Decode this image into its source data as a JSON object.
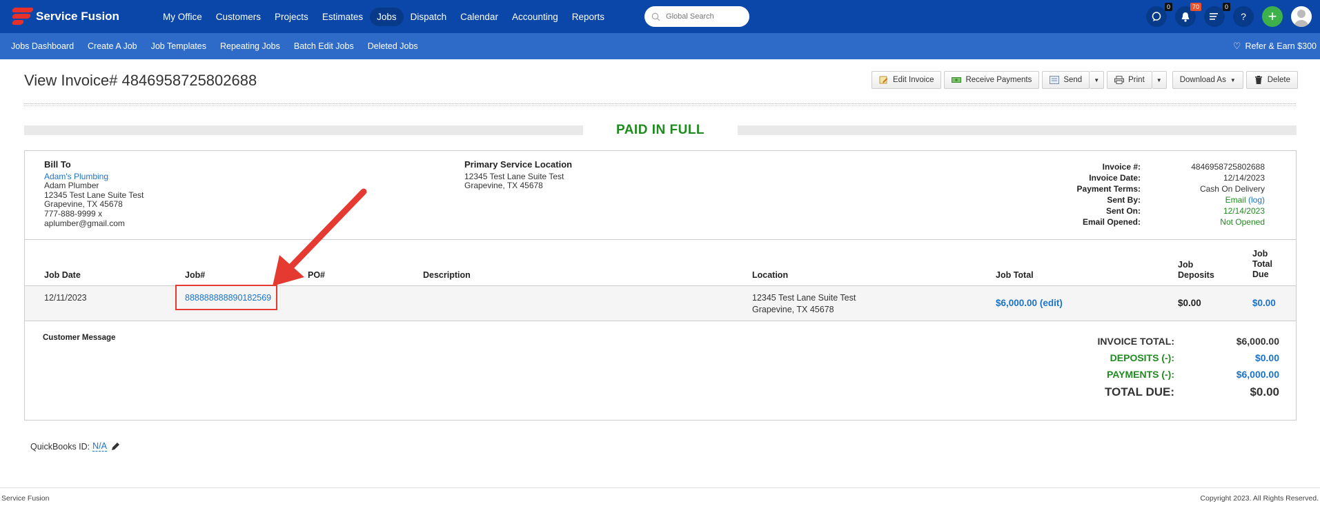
{
  "app": {
    "logo_text": "Service Fusion"
  },
  "mainnav": {
    "items": [
      "My Office",
      "Customers",
      "Projects",
      "Estimates",
      "Jobs",
      "Dispatch",
      "Calendar",
      "Accounting",
      "Reports"
    ],
    "active": "Jobs"
  },
  "search": {
    "placeholder": "Global Search"
  },
  "topicons": {
    "chat_count": "0",
    "notifications_count": "70",
    "tasks_count": "0",
    "help": "?",
    "add": "+"
  },
  "subnav": {
    "items": [
      "Jobs Dashboard",
      "Create A Job",
      "Job Templates",
      "Repeating Jobs",
      "Batch Edit Jobs",
      "Deleted Jobs"
    ],
    "refer": "Refer & Earn $300"
  },
  "page": {
    "title": "View Invoice# 4846958725802688",
    "status": "PAID IN FULL"
  },
  "actions": {
    "edit_invoice": "Edit Invoice",
    "receive_payments": "Receive Payments",
    "send": "Send",
    "print": "Print",
    "download_as": "Download As",
    "delete": "Delete"
  },
  "bill_to": {
    "heading": "Bill To",
    "customer_link": "Adam's Plumbing",
    "lines": [
      "Adam Plumber",
      "12345 Test Lane Suite Test",
      "Grapevine, TX 45678",
      "777-888-9999 x",
      "aplumber@gmail.com"
    ]
  },
  "service_location": {
    "heading": "Primary Service Location",
    "lines": [
      "12345 Test Lane Suite Test",
      "Grapevine, TX 45678"
    ]
  },
  "invoice_meta": {
    "invoice_no_label": "Invoice #:",
    "invoice_no": "4846958725802688",
    "invoice_date_label": "Invoice Date:",
    "invoice_date": "12/14/2023",
    "payment_terms_label": "Payment Terms:",
    "payment_terms": "Cash On Delivery",
    "sent_by_label": "Sent By:",
    "sent_by": "Email",
    "sent_by_log": "(log)",
    "sent_on_label": "Sent On:",
    "sent_on": "12/14/2023",
    "email_opened_label": "Email Opened:",
    "email_opened": "Not Opened"
  },
  "table": {
    "headers": {
      "job_date": "Job Date",
      "job_no": "Job#",
      "po_no": "PO#",
      "description": "Description",
      "location": "Location",
      "job_total": "Job Total",
      "job_deposits_1": "Job",
      "job_deposits_2": "Deposits",
      "due_1": "Job",
      "due_2": "Total",
      "due_3": "Due"
    },
    "row": {
      "job_date": "12/11/2023",
      "job_no": "888888888890182569",
      "location_1": "12345 Test Lane Suite Test",
      "location_2": "Grapevine, TX 45678",
      "job_total": "$6,000.00",
      "job_total_edit": "(edit)",
      "deposits": "$0.00",
      "due": "$0.00"
    }
  },
  "customer_message": "Customer Message",
  "totals": {
    "invoice_total_label": "INVOICE TOTAL:",
    "invoice_total": "$6,000.00",
    "deposits_label": "DEPOSITS (-):",
    "deposits": "$0.00",
    "payments_label": "PAYMENTS (-):",
    "payments": "$6,000.00",
    "total_due_label": "TOTAL DUE:",
    "total_due": "$0.00"
  },
  "quickbooks": {
    "label": "QuickBooks ID:",
    "value": "N/A"
  },
  "footer": {
    "left": "Service Fusion",
    "right": "Copyright 2023. All Rights Reserved."
  },
  "colors": {
    "nav": "#0a47a9",
    "subnav": "#2e6bc8",
    "paid": "#1f8a1f",
    "link": "#1a73c8",
    "highlight": "#e53a32"
  }
}
